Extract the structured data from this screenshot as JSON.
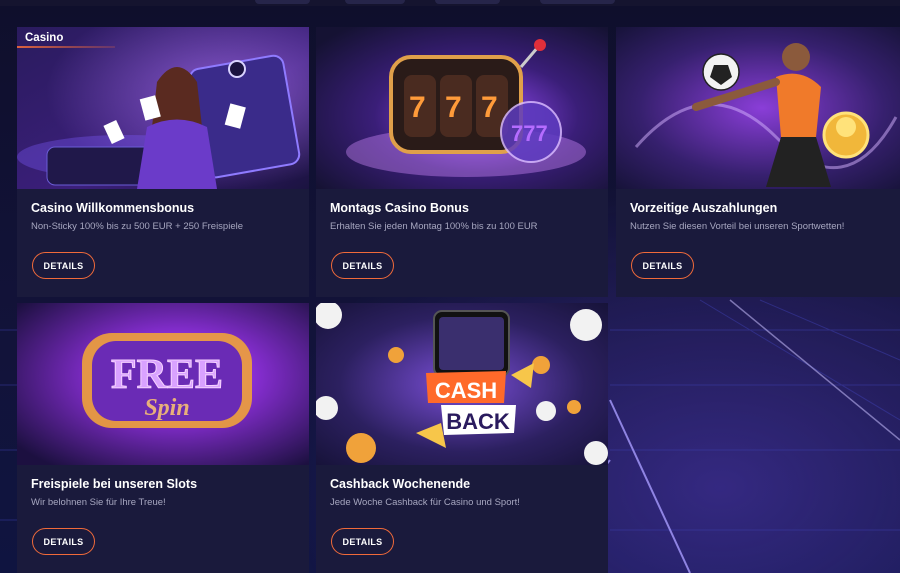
{
  "category_label": "Casino",
  "button_label": "DETAILS",
  "colors": {
    "accent": "#f06a3a",
    "card_bg": "#1a1a3c",
    "page_bg": "#0f0f2c",
    "desc": "#a7a7c0"
  },
  "promos": [
    {
      "title": "Casino Willkommensbonus",
      "description": "Non-Sticky 100% bis zu 500 EUR + 250 Freispiele",
      "image": "casino-hostess-cards"
    },
    {
      "title": "Montags Casino Bonus",
      "description": "Erhalten Sie jeden Montag 100% bis zu 100 EUR",
      "image": "slot-777-reels"
    },
    {
      "title": "Vorzeitige Auszahlungen",
      "description": "Nutzen Sie diesen Vorteil bei unseren Sportwetten!",
      "image": "football-player-trophy"
    },
    {
      "title": "Freispiele bei unseren Slots",
      "description": "Wir belohnen Sie für Ihre Treue!",
      "image": "free-spin-reels",
      "art_text": [
        "FREE",
        "Spin"
      ]
    },
    {
      "title": "Cashback Wochenende",
      "description": "Jede Woche Cashback für Casino und Sport!",
      "image": "cashback-phone-coins",
      "art_text": [
        "CASH",
        "BACK"
      ]
    }
  ]
}
